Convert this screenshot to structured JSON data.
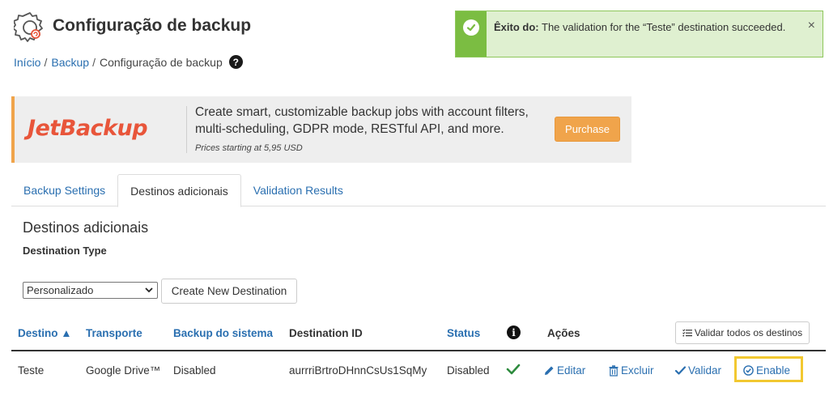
{
  "header": {
    "title": "Configuração de backup",
    "icon": "backup-gear-icon"
  },
  "breadcrumb": {
    "items": [
      {
        "label": "Início"
      },
      {
        "label": "Backup"
      }
    ],
    "current": "Configuração de backup",
    "separator": "/"
  },
  "alert": {
    "prefix": "Êxito do:",
    "message": "The validation for the “Teste” destination succeeded.",
    "close": "×",
    "color": "#7bbd42"
  },
  "promo": {
    "logo": "JetBackup",
    "text": "Create smart, customizable backup jobs with account filters, multi-scheduling, GDPR mode, RESTful API, and more.",
    "price": "Prices starting at 5,95 USD",
    "button": "Purchase",
    "accent": "#f0a44b"
  },
  "tabs": [
    {
      "label": "Backup Settings",
      "active": false
    },
    {
      "label": "Destinos adicionais",
      "active": true
    },
    {
      "label": "Validation Results",
      "active": false
    }
  ],
  "section": {
    "title": "Destinos adicionais",
    "destination_type_label": "Destination Type",
    "select_value": "Personalizado",
    "create_button": "Create New Destination"
  },
  "table": {
    "headers": {
      "destino": "Destino ▲",
      "transporte": "Transporte",
      "backup_sistema": "Backup do sistema",
      "destination_id": "Destination ID",
      "status": "Status",
      "info": "i",
      "acoes": "Ações"
    },
    "validate_all": "Validar todos os destinos",
    "rows": [
      {
        "destino": "Teste",
        "transporte": "Google Drive™",
        "backup_sistema": "Disabled",
        "destination_id": "aurrriBrtroDHnnCsUs1SqMy",
        "status": "Disabled",
        "validated": true,
        "actions": {
          "edit": "Editar",
          "delete": "Excluir",
          "validate": "Validar",
          "enable": "Enable"
        }
      }
    ]
  }
}
